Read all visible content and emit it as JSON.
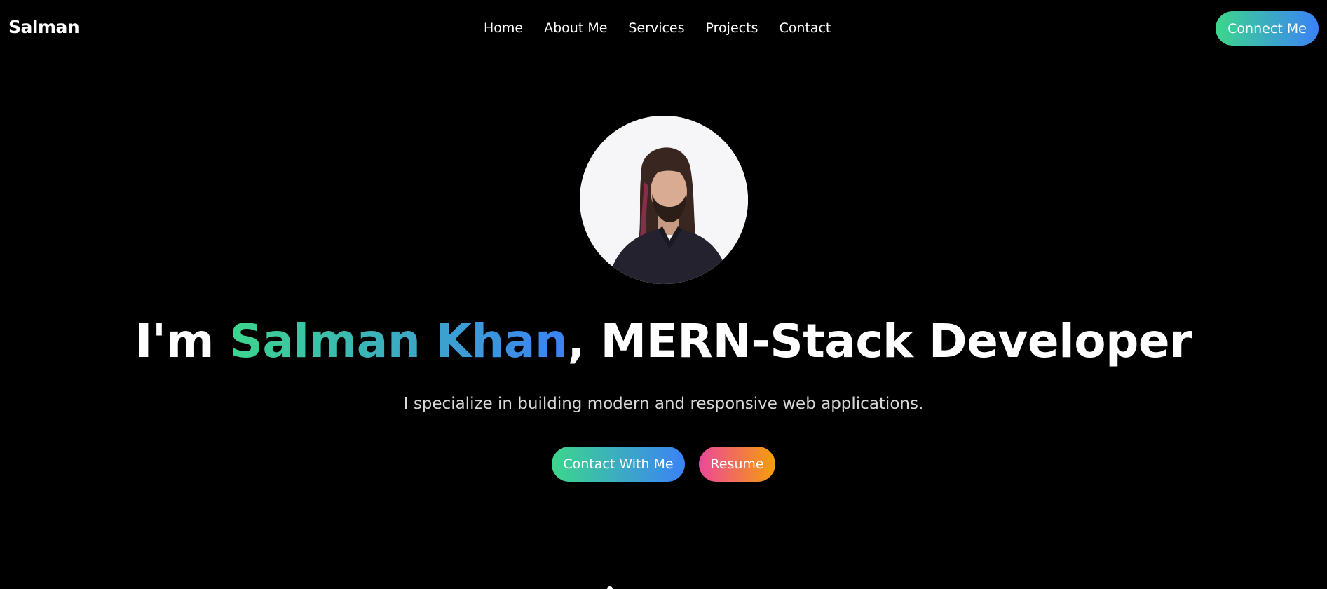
{
  "nav": {
    "brand": "Salman",
    "links": [
      {
        "label": "Home"
      },
      {
        "label": "About Me"
      },
      {
        "label": "Services"
      },
      {
        "label": "Projects"
      },
      {
        "label": "Contact"
      }
    ],
    "cta_label": "Connect Me"
  },
  "hero": {
    "headline_prefix": "I'm ",
    "headline_name": "Salman Khan",
    "headline_suffix": ", MERN-Stack Developer",
    "tagline": "I specialize in building modern and responsive web applications.",
    "primary_button": "Contact With Me",
    "secondary_button": "Resume"
  },
  "colors": {
    "background": "#000000",
    "gradient_green": "#3dd68c",
    "gradient_blue": "#3b82f6",
    "gradient_pink": "#ec4899",
    "gradient_orange": "#f59e0b"
  }
}
